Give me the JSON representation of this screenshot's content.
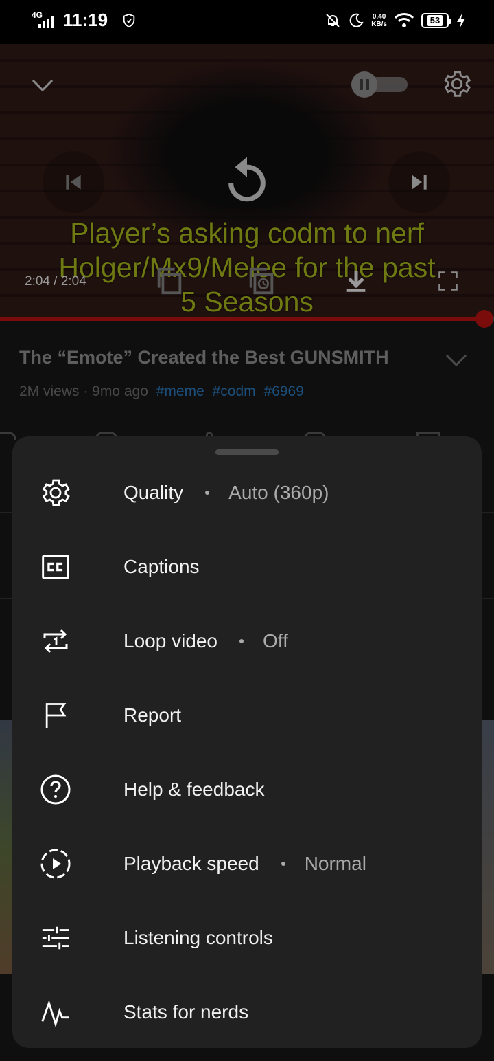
{
  "status_bar": {
    "network": "4G",
    "time": "11:19",
    "speed_value": "0.40",
    "speed_unit": "KB/s",
    "battery": "53"
  },
  "player": {
    "caption_line_1": "Player’s asking codm to nerf",
    "caption_line_2": "Holger/Mx9/Melee for the past",
    "caption_line_3": "5 Seasons",
    "time": "2:04 / 2:04",
    "progress": 0.98
  },
  "video": {
    "title": "The “Emote” Created the Best GUNSMITH",
    "views_age": "2M views · 9mo ago",
    "tags": [
      "#meme",
      "#codm",
      "#6969"
    ]
  },
  "menu": {
    "items": [
      {
        "label": "Quality",
        "value": "Auto (360p)",
        "icon": "gear-icon"
      },
      {
        "label": "Captions",
        "value": "",
        "icon": "cc-icon"
      },
      {
        "label": "Loop video",
        "value": "Off",
        "icon": "loop-icon"
      },
      {
        "label": "Report",
        "value": "",
        "icon": "flag-icon"
      },
      {
        "label": "Help & feedback",
        "value": "",
        "icon": "help-icon"
      },
      {
        "label": "Playback speed",
        "value": "Normal",
        "icon": "playback-speed-icon"
      },
      {
        "label": "Listening controls",
        "value": "",
        "icon": "sliders-icon"
      },
      {
        "label": "Stats for nerds",
        "value": "",
        "icon": "stats-icon"
      }
    ]
  },
  "colors": {
    "sheet_bg": "#212121",
    "progress": "#7a0c0c",
    "hashtag": "#1c4f7c"
  }
}
